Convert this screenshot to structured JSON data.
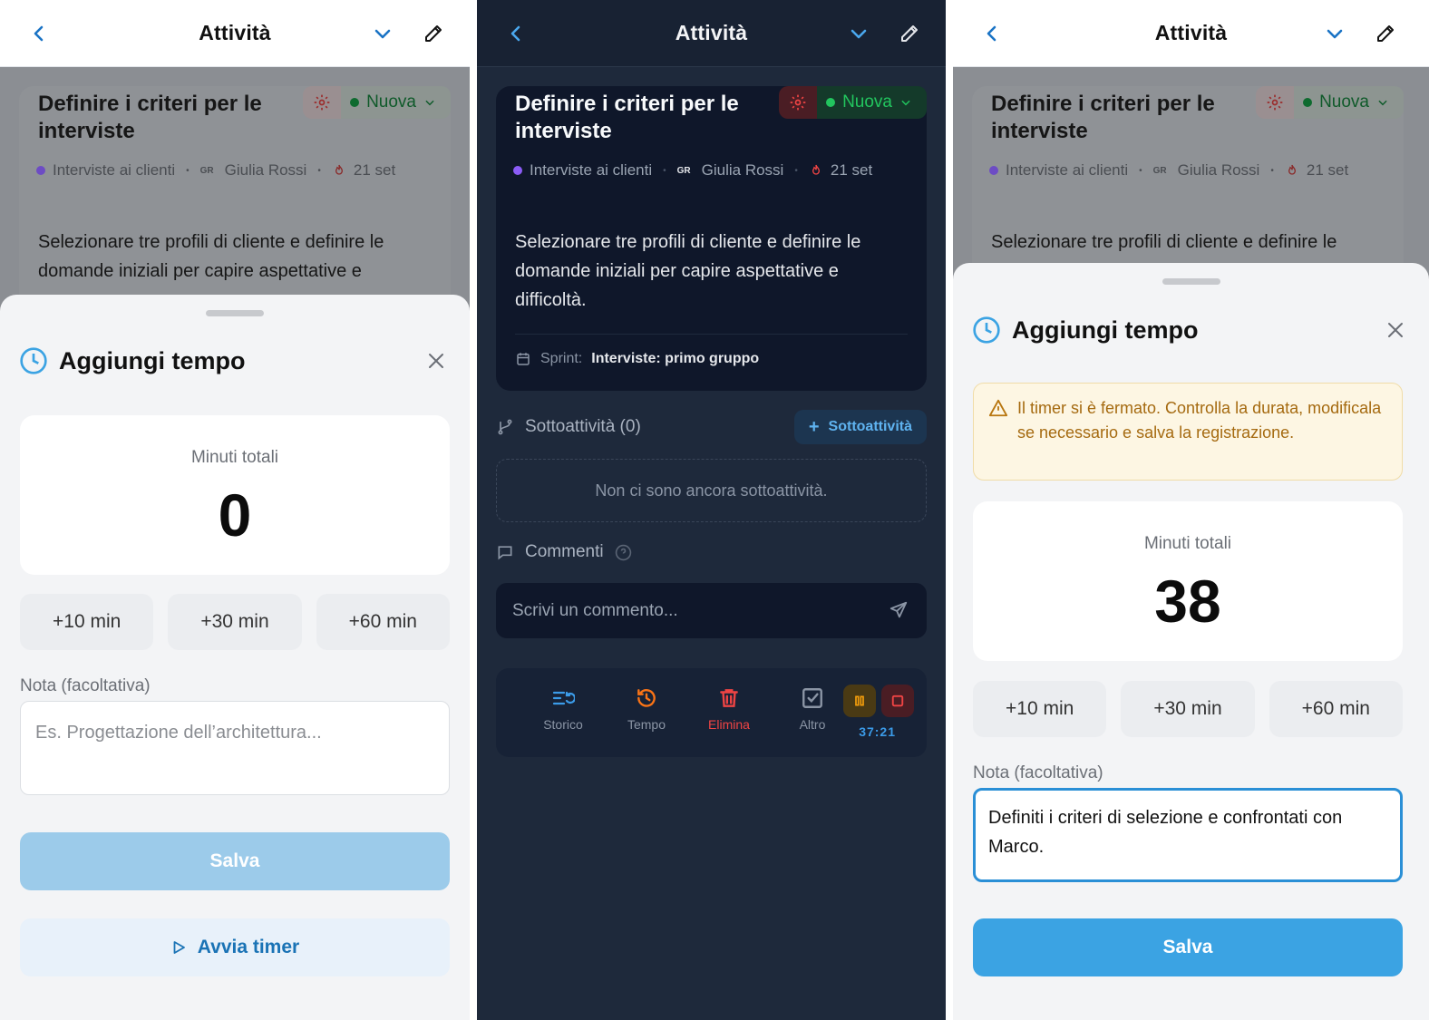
{
  "app": {
    "title": "Attività"
  },
  "task": {
    "title": "Definire i criteri per le interviste",
    "status": "Nuova",
    "project": "Interviste ai clienti",
    "assignee_initials": "GR",
    "assignee": "Giulia Rossi",
    "due": "21 set",
    "description": "Selezionare tre profili di cliente e definire le domande iniziali per capire aspettative e difficoltà.",
    "description_cut_p1": "Selezionare tre profili di cliente e definire le domande iniziali per capire aspettative e",
    "description_cut_p3": "Selezionare tre profili di cliente e definire le",
    "sprint_label": "Sprint:",
    "sprint_value": "Interviste: primo gruppo"
  },
  "subtasks": {
    "label": "Sottoattività (0)",
    "add_label": "Sottoattività",
    "empty": "Non ci sono ancora sottoattività."
  },
  "comments": {
    "label": "Commenti",
    "placeholder": "Scrivi un commento..."
  },
  "actions": {
    "history": "Storico",
    "time": "Tempo",
    "delete": "Elimina",
    "more": "Altro",
    "timer": "37:21"
  },
  "sheet": {
    "title": "Aggiungi tempo",
    "total_label": "Minuti totali",
    "quick": [
      "+10 min",
      "+30 min",
      "+60 min"
    ],
    "note_label": "Nota (facoltativa)",
    "note_placeholder": "Es. Progettazione dell’architettura...",
    "save": "Salva",
    "start_timer": "Avvia timer"
  },
  "sheet_empty": {
    "total": "0"
  },
  "sheet_filled": {
    "warning": "Il timer si è fermato. Controlla la durata, modificala se necessario e salva la registrazione.",
    "total": "38",
    "note_value": "Definiti i criteri di selezione e confrontati con Marco."
  },
  "colors": {
    "accent": "#3ba3e3",
    "accent_disabled": "#9ccbea",
    "status_green": "#16a34a",
    "danger": "#ef4444",
    "warning": "#f59e0b"
  }
}
